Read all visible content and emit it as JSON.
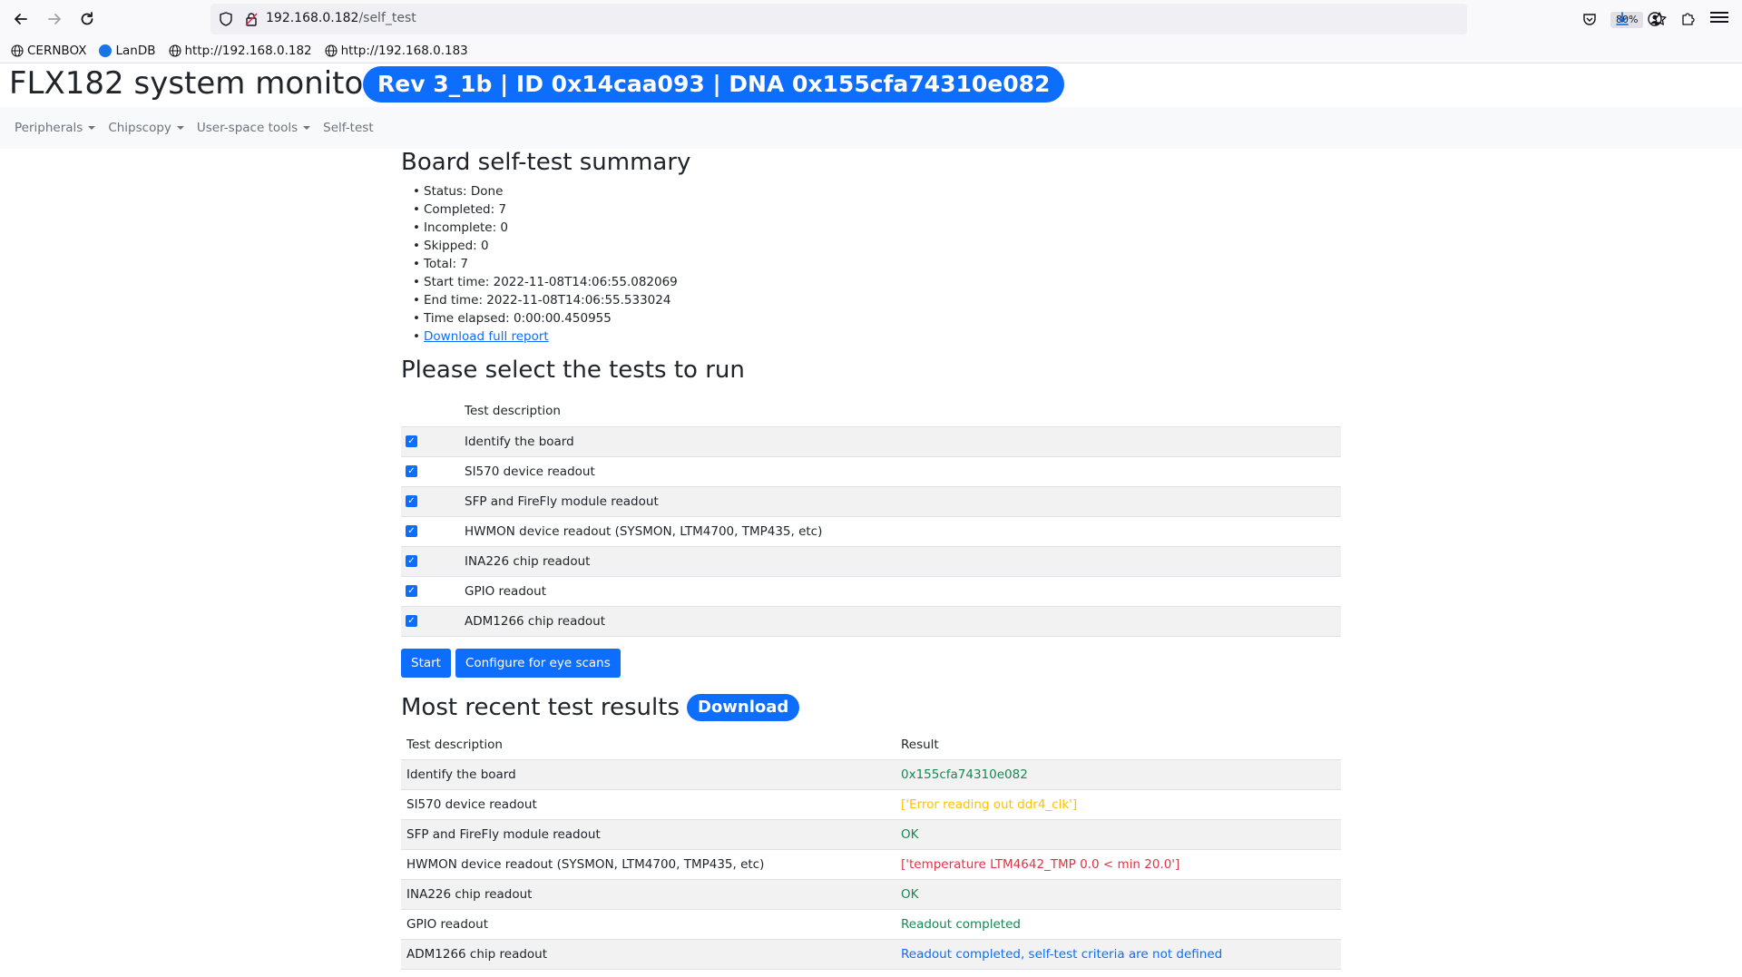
{
  "browser": {
    "url_host": "192.168.0.182",
    "url_path": "/self_test",
    "zoom": "80%",
    "bookmarks": [
      {
        "label": "CERNBOX",
        "icon": "globe-icon"
      },
      {
        "label": "LanDB",
        "icon": "cloud-icon"
      },
      {
        "label": "http://192.168.0.182",
        "icon": "globe-icon"
      },
      {
        "label": "http://192.168.0.183",
        "icon": "globe-icon"
      }
    ]
  },
  "header": {
    "title": "FLX182 system monitor",
    "badge": "Rev 3_1b | ID 0x14caa093 | DNA 0x155cfa74310e082"
  },
  "nav": {
    "items": [
      {
        "label": "Peripherals"
      },
      {
        "label": "Chipscopy"
      },
      {
        "label": "User-space tools"
      },
      {
        "label": "Self-test"
      }
    ]
  },
  "summary": {
    "title": "Board self-test summary",
    "items": [
      "Status: Done",
      "Completed: 7",
      "Incomplete: 0",
      "Skipped: 0",
      "Total: 7",
      "Start time: 2022-11-08T14:06:55.082069",
      "End time: 2022-11-08T14:06:55.533024",
      "Time elapsed: 0:00:00.450955"
    ],
    "report_link": "Download full report"
  },
  "select": {
    "title": "Please select the tests to run",
    "column_header": "Test description",
    "tests": [
      {
        "label": "Identify the board",
        "checked": true
      },
      {
        "label": "SI570 device readout",
        "checked": true
      },
      {
        "label": "SFP and FireFly module readout",
        "checked": true
      },
      {
        "label": "HWMON device readout (SYSMON, LTM4700, TMP435, etc)",
        "checked": true
      },
      {
        "label": "INA226 chip readout",
        "checked": true
      },
      {
        "label": "GPIO readout",
        "checked": true
      },
      {
        "label": "ADM1266 chip readout",
        "checked": true
      }
    ],
    "start_label": "Start",
    "configure_label": "Configure for eye scans"
  },
  "results": {
    "title": "Most recent test results",
    "download_label": "Download",
    "col_description": "Test description",
    "col_result": "Result",
    "rows": [
      {
        "test": "Identify the board",
        "result": "0x155cfa74310e082",
        "status": "ok",
        "color": "#198754"
      },
      {
        "test": "SI570 device readout",
        "result": "['Error reading out ddr4_clk']",
        "status": "warning",
        "color": "#ffc107"
      },
      {
        "test": "SFP and FireFly module readout",
        "result": "OK",
        "status": "ok",
        "color": "#198754"
      },
      {
        "test": "HWMON device readout (SYSMON, LTM4700, TMP435, etc)",
        "result": "['temperature LTM4642_TMP 0.0 < min 20.0']",
        "status": "error",
        "color": "#dc3545"
      },
      {
        "test": "INA226 chip readout",
        "result": "OK",
        "status": "ok",
        "color": "#198754"
      },
      {
        "test": "GPIO readout",
        "result": "Readout completed",
        "status": "ok",
        "color": "#198754"
      },
      {
        "test": "ADM1266 chip readout",
        "result": "Readout completed, self-test criteria are not defined",
        "status": "info",
        "color": "#0d6efd"
      }
    ]
  },
  "colors": {
    "accent": "#0d6efd",
    "ok": "#198754",
    "warning": "#ffc107",
    "error": "#dc3545"
  }
}
